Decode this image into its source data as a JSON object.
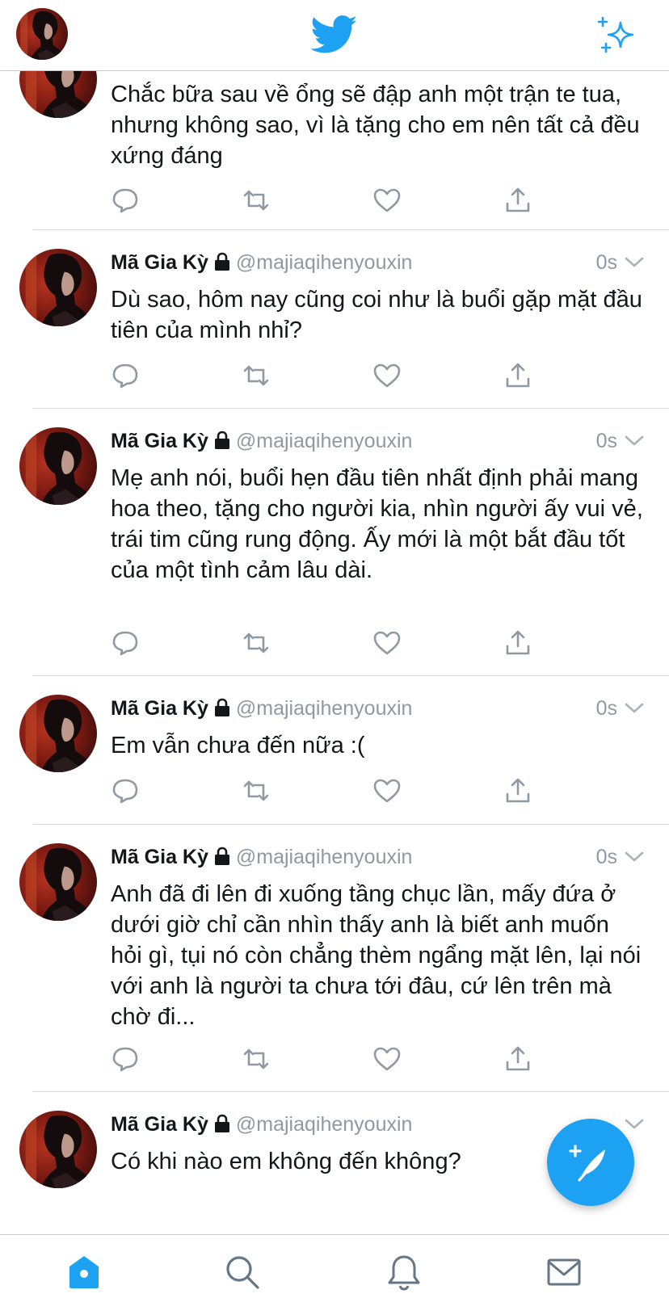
{
  "header": {
    "profile_icon": "avatar",
    "logo_icon": "twitter-bird-icon",
    "action_icon": "sparkle-icon",
    "accent_color": "#1da1f2"
  },
  "tweets": [
    {
      "name": "",
      "handle": "",
      "time": "",
      "text": "Chắc bữa sau về ổng sẽ đập anh một trận te tua, nhưng không sao, vì là tặng cho em nên tất cả đều xứng đáng"
    },
    {
      "name": "Mã Gia Kỳ",
      "handle": "@majiaqihenyouxin",
      "time": "0s",
      "text": "Dù sao, hôm nay cũng coi như là buổi gặp mặt đầu tiên của mình nhỉ?"
    },
    {
      "name": "Mã Gia Kỳ",
      "handle": "@majiaqihenyouxin",
      "time": "0s",
      "text": "Mẹ anh nói, buổi hẹn đầu tiên nhất định phải mang hoa theo, tặng cho người kia, nhìn người ấy vui vẻ, trái tim cũng rung động. Ấy mới là một bắt đầu tốt của một tình cảm lâu dài."
    },
    {
      "name": "Mã Gia Kỳ",
      "handle": "@majiaqihenyouxin",
      "time": "0s",
      "text": "Em vẫn chưa đến nữa :("
    },
    {
      "name": "Mã Gia Kỳ",
      "handle": "@majiaqihenyouxin",
      "time": "0s",
      "text": "Anh đã đi lên đi xuống tầng chục lần, mấy đứa ở dưới giờ chỉ cần nhìn thấy anh là biết anh muốn hỏi gì, tụi nó còn chẳng thèm ngẩng mặt lên, lại nói với anh là người ta chưa tới đâu, cứ lên trên mà chờ đi..."
    },
    {
      "name": "Mã Gia Kỳ",
      "handle": "@majiaqihenyouxin",
      "time": "",
      "text": "Có khi nào em không đến không?"
    }
  ],
  "tweet_actions": [
    "reply-icon",
    "retweet-icon",
    "like-icon",
    "share-icon"
  ],
  "compose_button": "compose-tweet-icon",
  "tabbar": {
    "items": [
      "home-icon",
      "search-icon",
      "notifications-icon",
      "messages-icon"
    ],
    "active": "home-icon"
  }
}
